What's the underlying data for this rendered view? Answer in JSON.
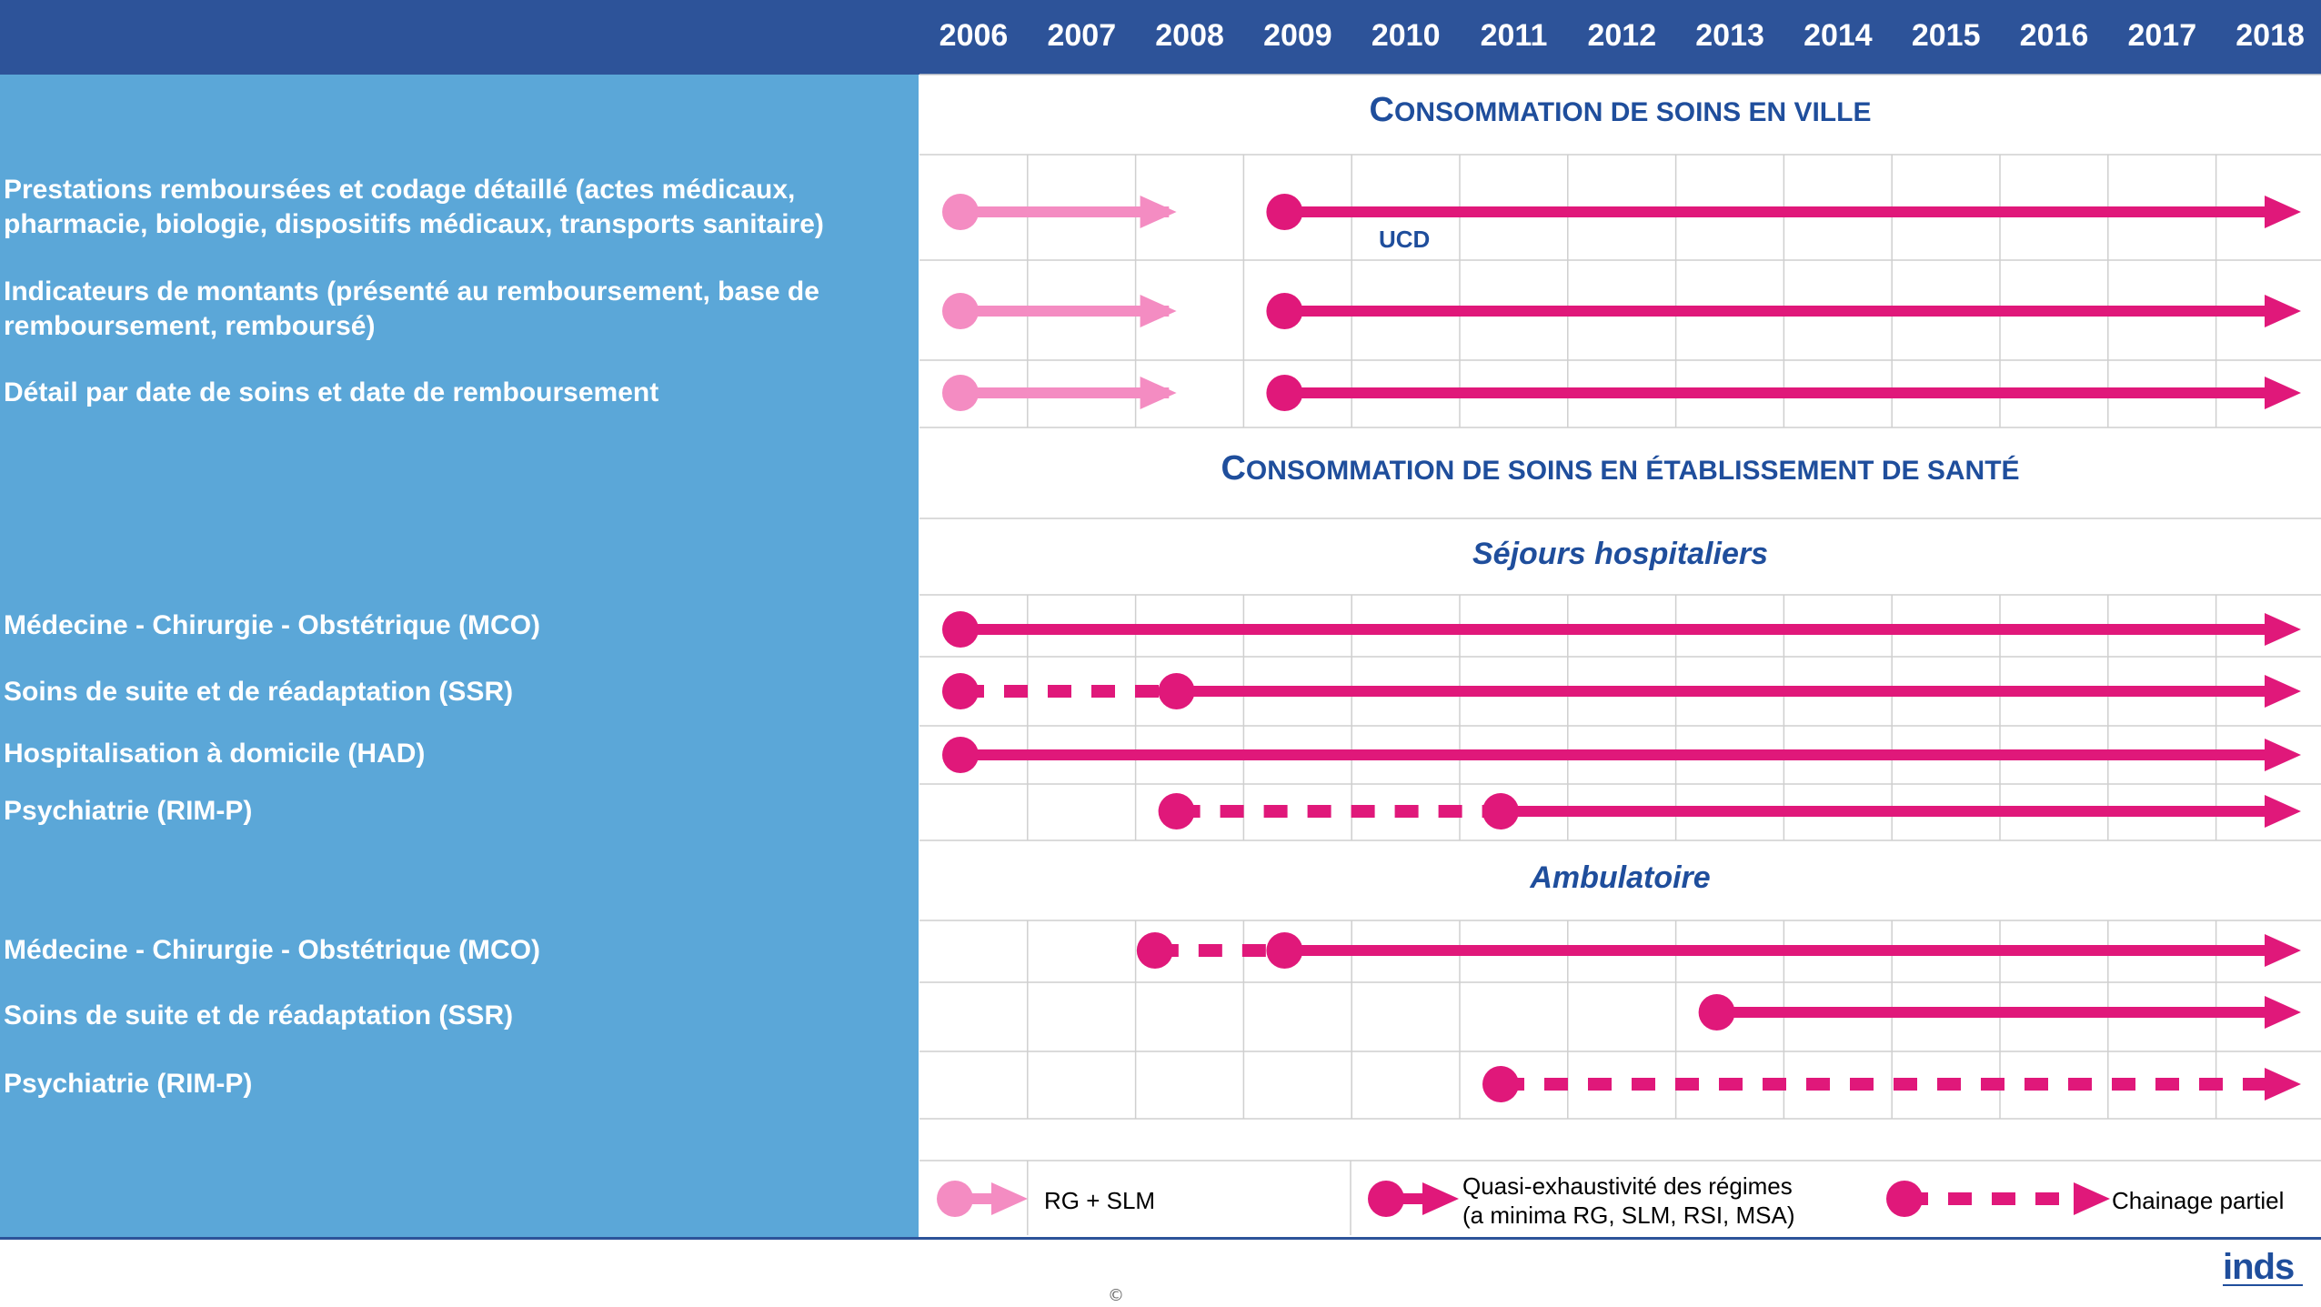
{
  "header": {
    "years": [
      "2006",
      "2007",
      "2008",
      "2009",
      "2010",
      "2011",
      "2012",
      "2013",
      "2014",
      "2015",
      "2016",
      "2017",
      "2018"
    ]
  },
  "sections": {
    "ville": {
      "first": "C",
      "rest": "ONSOMMATION DE SOINS EN VILLE"
    },
    "etab": {
      "first": "C",
      "rest": "ONSOMMATION DE SOINS EN ÉTABLISSEMENT DE SANTÉ"
    },
    "sejours": "Séjours hospitaliers",
    "ambulatoire": "Ambulatoire"
  },
  "rows": {
    "prestations": "Prestations remboursées et codage détaillé (actes médicaux, pharmacie, biologie, dispositifs médicaux, transports sanitaire)",
    "indicateurs": "Indicateurs de montants (présenté au remboursement, base de remboursement, remboursé)",
    "detail": "Détail par date de soins et date de remboursement",
    "mco": "Médecine - Chirurgie - Obstétrique (MCO)",
    "ssr": "Soins de suite et de réadaptation (SSR)",
    "had": "Hospitalisation à domicile (HAD)",
    "psy": "Psychiatrie (RIM-P)",
    "amb_mco": "Médecine - Chirurgie - Obstétrique (MCO)",
    "amb_ssr": "Soins de suite et de réadaptation (SSR)",
    "amb_psy": "Psychiatrie (RIM-P)"
  },
  "notes": {
    "ucd": "UCD"
  },
  "legend": {
    "rg_slm": "RG + SLM",
    "quasi_line1": "Quasi-exhaustivité des régimes",
    "quasi_line2": "(a minima RG, SLM, RSI, MSA)",
    "chainage": "Chainage partiel"
  },
  "colors": {
    "header_bg": "#2d5399",
    "left_panel": "#5ba7d8",
    "title_blue": "#1f4e9c",
    "magenta": "#e0187a",
    "light_pink": "#f48cc2",
    "grid_line": "#cfcfcf"
  },
  "timeline": [
    {
      "row": "prestations",
      "segments": [
        {
          "style": "light",
          "from": 2006.0,
          "to": 2008.25
        },
        {
          "style": "solid",
          "from": 2009.0,
          "to": 2018.35
        }
      ]
    },
    {
      "row": "indicateurs",
      "segments": [
        {
          "style": "light",
          "from": 2006.0,
          "to": 2008.25
        },
        {
          "style": "solid",
          "from": 2009.0,
          "to": 2018.35
        }
      ]
    },
    {
      "row": "detail",
      "segments": [
        {
          "style": "light",
          "from": 2006.0,
          "to": 2008.25
        },
        {
          "style": "solid",
          "from": 2009.0,
          "to": 2018.35
        }
      ]
    },
    {
      "row": "mco",
      "segments": [
        {
          "style": "solid",
          "from": 2006.0,
          "to": 2018.35
        }
      ]
    },
    {
      "row": "ssr",
      "segments": [
        {
          "style": "dashed",
          "from": 2006.0,
          "to": 2008.0
        },
        {
          "style": "solid",
          "from": 2008.0,
          "to": 2018.35
        }
      ]
    },
    {
      "row": "had",
      "segments": [
        {
          "style": "solid",
          "from": 2006.0,
          "to": 2018.35
        }
      ]
    },
    {
      "row": "psy",
      "segments": [
        {
          "style": "dashed",
          "from": 2008.0,
          "to": 2011.0
        },
        {
          "style": "solid",
          "from": 2011.0,
          "to": 2018.35
        }
      ]
    },
    {
      "row": "amb_mco",
      "segments": [
        {
          "style": "dashed",
          "from": 2007.8,
          "to": 2009.0
        },
        {
          "style": "solid",
          "from": 2009.0,
          "to": 2018.35
        }
      ]
    },
    {
      "row": "amb_ssr",
      "segments": [
        {
          "style": "solid",
          "from": 2013.0,
          "to": 2018.35
        }
      ]
    },
    {
      "row": "amb_psy",
      "segments": [
        {
          "style": "dashed",
          "from": 2011.0,
          "to": 2018.35
        }
      ]
    }
  ]
}
